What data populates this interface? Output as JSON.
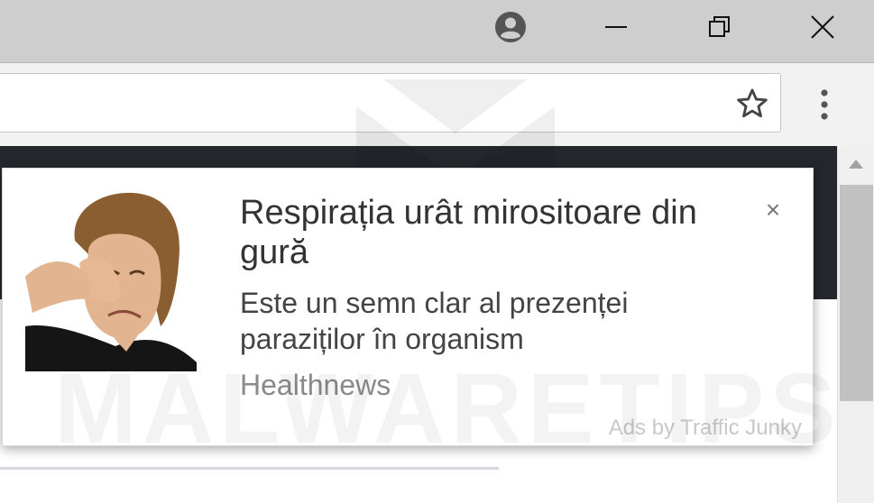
{
  "window": {
    "profile_icon": "profile-icon",
    "minimize_icon": "minimize-icon",
    "restore_icon": "restore-icon",
    "close_icon": "close-icon"
  },
  "toolbar": {
    "bookmark_icon": "star-icon",
    "menu_icon": "more-vert-icon"
  },
  "notification": {
    "title": "Respirația urât mirositoare din gură",
    "description": "Este un semn clar al prezenței paraziților în organism",
    "source": "Healthnews",
    "ads_label": "Ads by Traffic Junky",
    "close_label": "×",
    "image_icon": "ad-photo"
  },
  "watermark": {
    "text": "MALWARETIPS"
  },
  "colors": {
    "titlebar": "#cecece",
    "toolbar": "#f2f2f2",
    "page_header": "#24282c",
    "scrollbar_thumb": "#c1c1c1"
  }
}
